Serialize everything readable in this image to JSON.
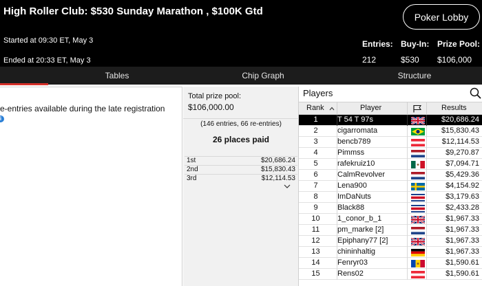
{
  "header": {
    "title": "High Roller Club: $530 Sunday Marathon , $100K Gtd",
    "lobby_button": "Poker Lobby",
    "started": "Started at 09:30 ET, May 3",
    "ended": "Ended at 20:33 ET, May 3",
    "stats": {
      "entries_label": "Entries:",
      "entries_value": "212",
      "buyin_label": "Buy-In:",
      "buyin_value": "$530",
      "prize_label": "Prize Pool:",
      "prize_value": "$106,000"
    }
  },
  "tabs": [
    {
      "label": "Tables",
      "active": true
    },
    {
      "label": "Chip Graph",
      "active": false
    },
    {
      "label": "Structure",
      "active": false
    }
  ],
  "left_panel": {
    "late_reg_text": "re-entries available during the late registration",
    "info_icon": "info-icon"
  },
  "prize_panel": {
    "pool_label": "Total prize pool:",
    "pool_value": "$106,000.00",
    "entries_detail": "(146 entries, 66 re-entries)",
    "places_paid": "26 places paid",
    "payouts": [
      {
        "place": "1st",
        "amount": "$20,686.24"
      },
      {
        "place": "2nd",
        "amount": "$15,830.43"
      },
      {
        "place": "3rd",
        "amount": "$12,114.53"
      }
    ]
  },
  "players": {
    "title": "Players",
    "columns": {
      "rank": "Rank",
      "player": "Player",
      "results": "Results"
    },
    "selected_index": 0,
    "rows": [
      {
        "rank": "1",
        "name": "T 54 T 97s",
        "flag": "uk",
        "result": "$20,686.24"
      },
      {
        "rank": "2",
        "name": "cigarromata",
        "flag": "brazil",
        "result": "$15,830.43"
      },
      {
        "rank": "3",
        "name": "bencb789",
        "flag": "austria",
        "result": "$12,114.53"
      },
      {
        "rank": "4",
        "name": "Pimmss",
        "flag": "netherlands",
        "result": "$9,270.87"
      },
      {
        "rank": "5",
        "name": "rafekruiz10",
        "flag": "mexico",
        "result": "$7,094.71"
      },
      {
        "rank": "6",
        "name": "CalmRevolver",
        "flag": "netherlands",
        "result": "$5,429.36"
      },
      {
        "rank": "7",
        "name": "Lena900",
        "flag": "sweden",
        "result": "$4,154.92"
      },
      {
        "rank": "8",
        "name": "ImDaNuts",
        "flag": "costa-rica",
        "result": "$3,179.63"
      },
      {
        "rank": "9",
        "name": "Black88",
        "flag": "costa-rica",
        "result": "$2,433.28"
      },
      {
        "rank": "10",
        "name": "1_conor_b_1",
        "flag": "uk",
        "result": "$1,967.33"
      },
      {
        "rank": "11",
        "name": "pm_marke [2]",
        "flag": "netherlands",
        "result": "$1,967.33"
      },
      {
        "rank": "12",
        "name": "Epiphany77 [2]",
        "flag": "uk",
        "result": "$1,967.33"
      },
      {
        "rank": "13",
        "name": "chininhaltig",
        "flag": "germany",
        "result": "$1,967.33"
      },
      {
        "rank": "14",
        "name": "Fenryr03",
        "flag": "moldova",
        "result": "$1,590.61"
      },
      {
        "rank": "15",
        "name": "Rens02",
        "flag": "austria",
        "result": "$1,590.61"
      }
    ]
  },
  "colors": {
    "header_bg": "#000000",
    "tab_bar_bg": "#1c1c1c",
    "active_tab_accent": "#d6312a",
    "selected_row_bg": "#000000"
  }
}
